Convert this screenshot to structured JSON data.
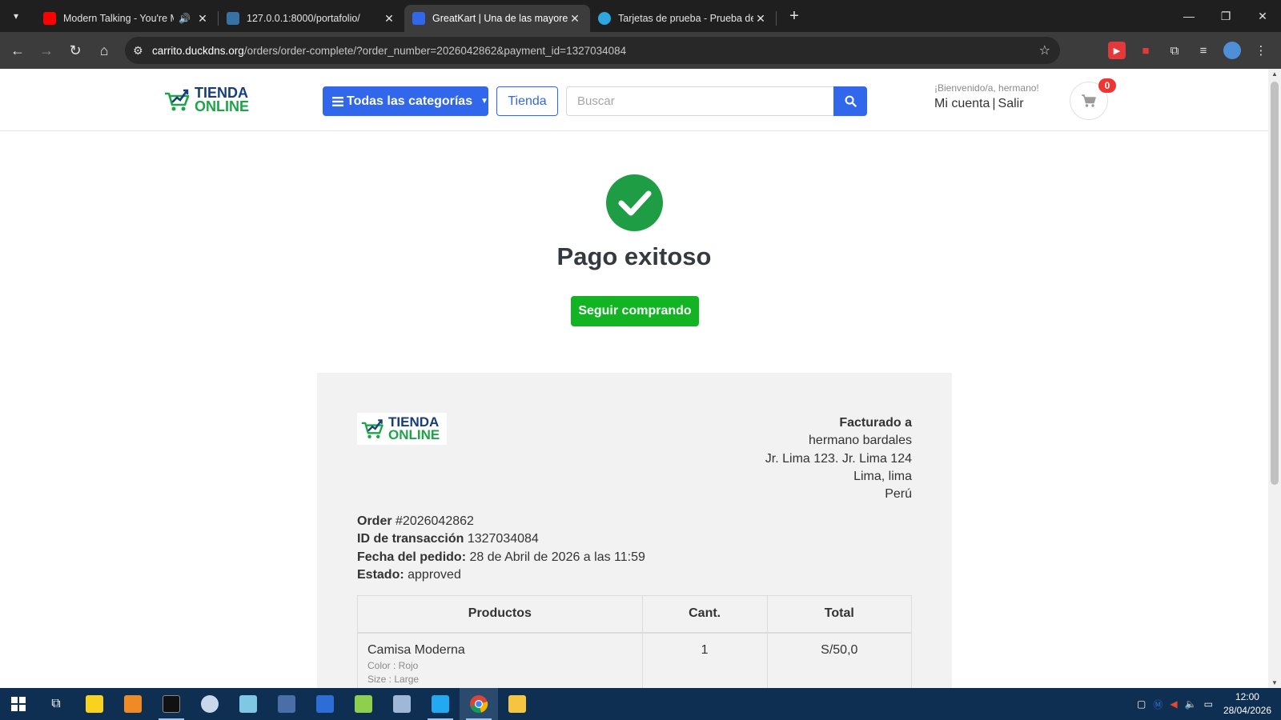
{
  "browser": {
    "tabs": [
      {
        "title": "Modern Talking - You're My",
        "favicon_color": "#ff0000",
        "audio": true,
        "active": false
      },
      {
        "title": "127.0.0.1:8000/portafolio/",
        "favicon_color": "#3572a5",
        "audio": false,
        "active": false
      },
      {
        "title": "GreatKart | Una de las mayores",
        "favicon_color": "#3167eb",
        "audio": false,
        "active": true
      },
      {
        "title": "Tarjetas de prueba - Prueba de",
        "favicon_color": "#2ea7e0",
        "audio": false,
        "active": false
      }
    ],
    "url_host": "carrito.duckdns.org",
    "url_path": "/orders/order-complete/?order_number=2026042862&payment_id=1327034084"
  },
  "header": {
    "logo_line1": "TIENDA",
    "logo_line2": "ONLINE",
    "categories_label": "Todas las categorías",
    "store_label": "Tienda",
    "search_placeholder": "Buscar",
    "welcome": "¡Bienvenido/a, hermano!",
    "account_label": "Mi cuenta",
    "logout_label": "Salir",
    "cart_count": "0"
  },
  "success": {
    "title": "Pago exitoso",
    "continue_label": "Seguir comprando"
  },
  "invoice": {
    "billing": {
      "heading": "Facturado a",
      "name": "hermano bardales",
      "address": "Jr. Lima 123. Jr. Lima 124",
      "city": "Lima, lima",
      "country": "Perú"
    },
    "meta": {
      "order_label": "Order",
      "order_value": "#2026042862",
      "transaction_label": "ID de transacción",
      "transaction_value": "1327034084",
      "date_label": "Fecha del pedido:",
      "date_value": "28 de Abril de 2026 a las 11:59",
      "status_label": "Estado:",
      "status_value": "approved"
    },
    "table": {
      "headers": [
        "Productos",
        "Cant.",
        "Total"
      ],
      "rows": [
        {
          "product": "Camisa Moderna",
          "variations": [
            "Color : Rojo",
            "Size : Large"
          ],
          "qty": "1",
          "total": "S/50,0"
        }
      ]
    }
  },
  "taskbar": {
    "time": "12:00",
    "date": "28/04/2026"
  },
  "colors": {
    "primary": "#3167eb",
    "success_button": "#13b423",
    "success_check": "#1f9d44",
    "badge": "#ef3434",
    "logo_blue": "#173d7a",
    "logo_green": "#1fa34a"
  }
}
